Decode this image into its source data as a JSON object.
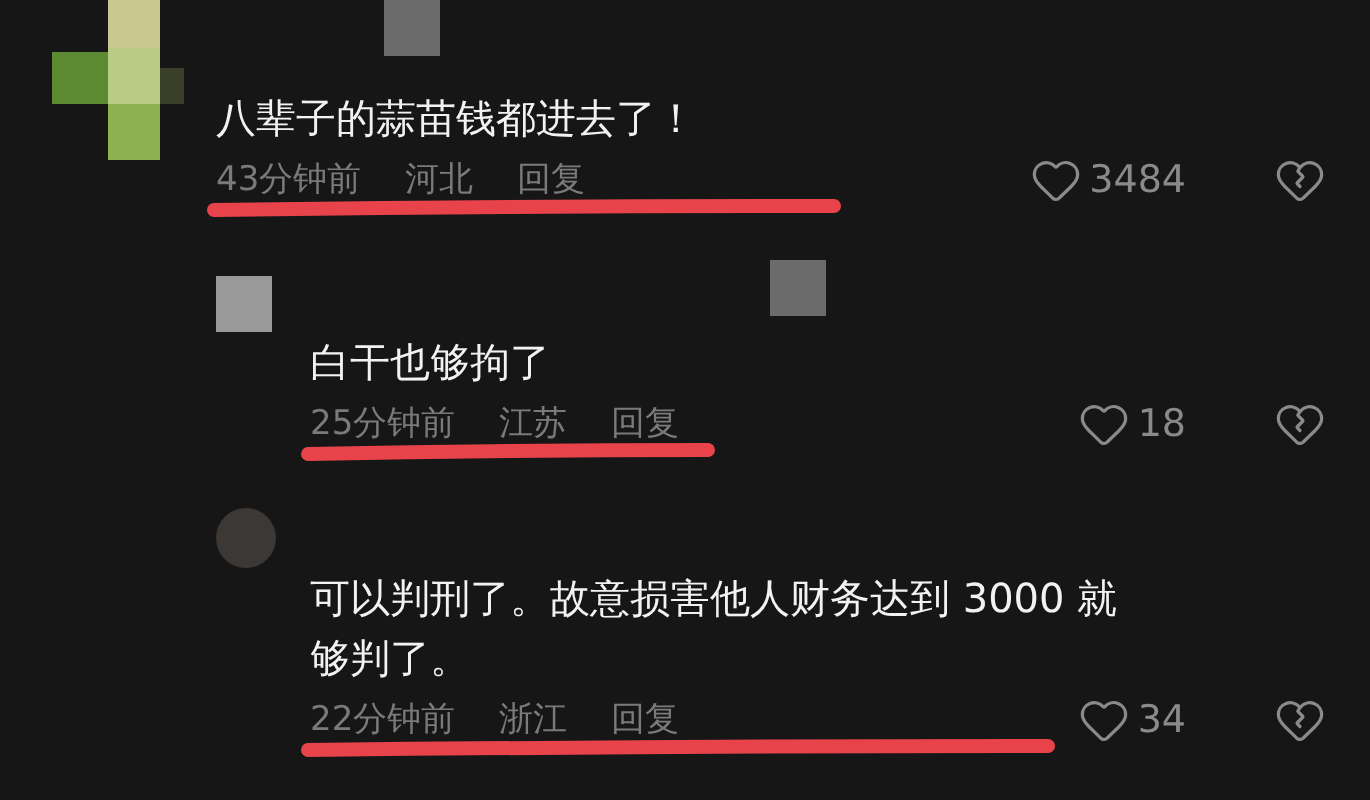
{
  "comment": {
    "text": "八辈子的蒜苗钱都进去了！",
    "time": "43分钟前",
    "region": "河北",
    "reply": "回复",
    "likes": "3484",
    "replies": [
      {
        "text": "白干也够拘了",
        "time": "25分钟前",
        "region": "江苏",
        "reply": "回复",
        "likes": "18"
      },
      {
        "text": "可以判刑了。故意损害他人财务达到 3000 就够判了。",
        "time": "22分钟前",
        "region": "浙江",
        "reply": "回复",
        "likes": "34"
      }
    ]
  }
}
